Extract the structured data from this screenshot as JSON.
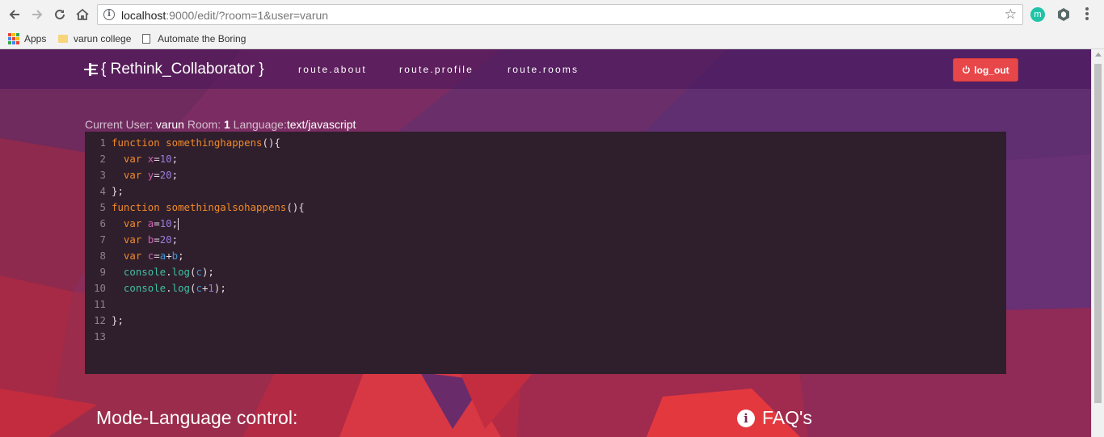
{
  "browser": {
    "url_host": "localhost",
    "url_rest": ":9000/edit/?room=1&user=varun",
    "extension_m": "m",
    "bookmarks": [
      {
        "label": "Apps"
      },
      {
        "label": "varun college"
      },
      {
        "label": "Automate the Boring"
      }
    ]
  },
  "navbar": {
    "brand": "{ Rethink_Collaborator }",
    "links": [
      "route.about",
      "route.profile",
      "route.rooms"
    ],
    "logout_label": "log_out",
    "logout_color": "#e8474a"
  },
  "session": {
    "user_label": "Current User: ",
    "user": "varun",
    "room_label": " Room: ",
    "room": "1",
    "language_label": " Language:",
    "language": "text/javascript"
  },
  "editor": {
    "background": "#2f1f2c",
    "line_numbers": [
      "1",
      "2",
      "3",
      "4",
      "5",
      "6",
      "7",
      "8",
      "9",
      "10",
      "11",
      "12",
      "13"
    ],
    "lines": [
      "function somethinghappens(){",
      "  var x=10;",
      "  var y=20;",
      "};",
      "function somethingalsohappens(){",
      "  var a=10;",
      "  var b=20;",
      "  var c=a+b;",
      "  console.log(c);",
      "  console.log(c+1);",
      "",
      "};",
      ""
    ]
  },
  "sections": {
    "mode_title": "Mode-Language control:",
    "faq_title": "FAQ's"
  }
}
